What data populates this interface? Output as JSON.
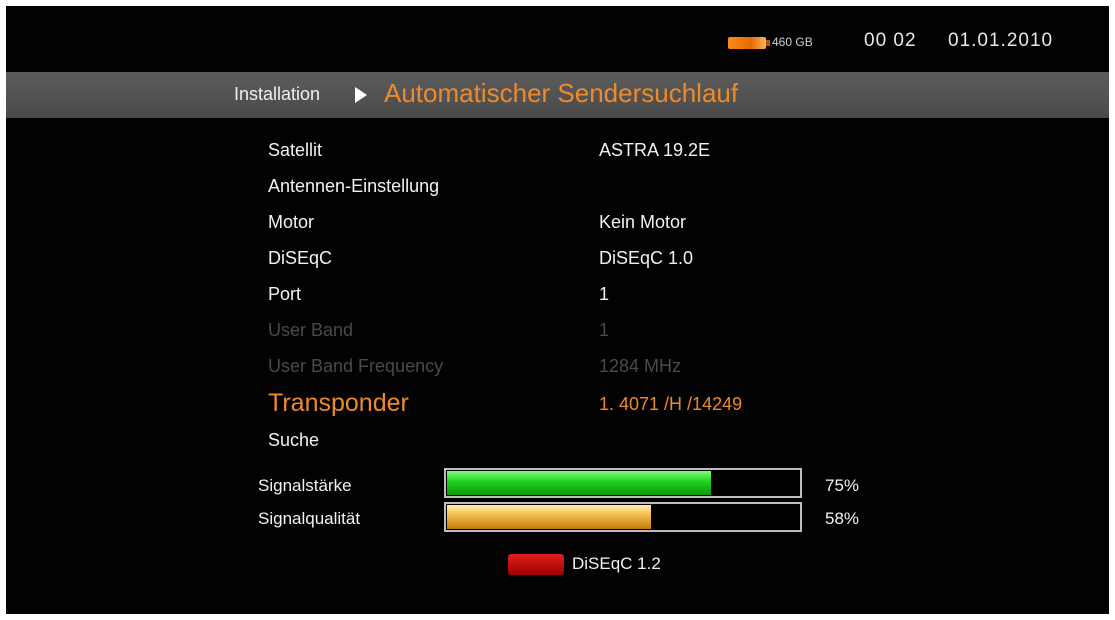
{
  "status": {
    "hdd_icon": "hdd-icon",
    "hdd_size": "460 GB",
    "time": "00 02",
    "date": "01.01.2010"
  },
  "header": {
    "breadcrumb_root": "Installation",
    "breadcrumb_current": "Automatischer Sendersuchlauf"
  },
  "menu": {
    "items": [
      {
        "label": "Satellit",
        "value": "ASTRA 19.2E"
      },
      {
        "label": "Antennen-Einstellung",
        "value": ""
      },
      {
        "label": "Motor",
        "value": "Kein Motor"
      },
      {
        "label": "DiSEqC",
        "value": "DiSEqC 1.0"
      },
      {
        "label": "Port",
        "value": "1"
      },
      {
        "label": "User Band",
        "value": "1"
      },
      {
        "label": "User Band Frequency",
        "value": "1284 MHz"
      },
      {
        "label": "Transponder",
        "value": "1. 4071 /H /14249"
      },
      {
        "label": "Suche",
        "value": ""
      }
    ]
  },
  "signal": {
    "strength": {
      "label": "Signalstärke",
      "percent_text": "75%",
      "level": 0.75
    },
    "quality": {
      "label": "Signalqualität",
      "percent_text": "58%",
      "level": 0.58
    }
  },
  "footer": {
    "red_key_label": "DiSEqC 1.2"
  },
  "colors": {
    "accent": "#ee8a2a",
    "strength_bar": "#1fd01f",
    "quality_bar": "#f2c050",
    "red_key": "#c00000",
    "disabled_text": "#4a4a4a"
  }
}
